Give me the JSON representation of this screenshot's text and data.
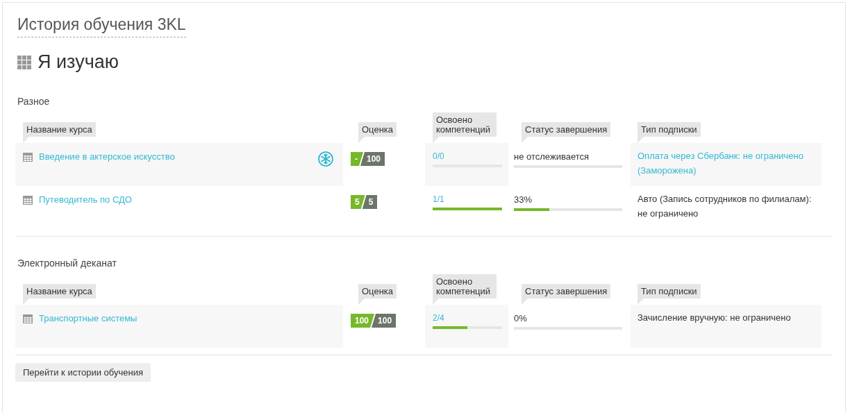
{
  "page_title": "История обучения 3KL",
  "heading": "Я изучаю",
  "sections": [
    {
      "title": "Разное",
      "columns": [
        "Название курса",
        "Оценка",
        "Освоено компетенций",
        "Статус завершения",
        "Тип подписки"
      ],
      "rows": [
        {
          "shaded": true,
          "name": "Введение в актерское искусство",
          "frozen": true,
          "grade": "-",
          "grade_max": "100",
          "competence": {
            "text": "0/0",
            "level": 0
          },
          "status": {
            "text": "не отслеживается",
            "level": 0
          },
          "subscription": "Оплата через Сбербанк: не ограничено (Заморожена)",
          "subscription_link": true
        },
        {
          "shaded": false,
          "name": "Путеводитель по СДО",
          "frozen": false,
          "grade": "5",
          "grade_max": "5",
          "competence": {
            "text": "1/1",
            "level": 1
          },
          "status": {
            "text": "33%",
            "level": 0.33
          },
          "subscription": "Авто (Запись сотрудников по филиалам): не ограничено",
          "subscription_link": false
        }
      ]
    },
    {
      "title": "Электронный деканат",
      "columns": [
        "Название курса",
        "Оценка",
        "Освоено компетенций",
        "Статус завершения",
        "Тип подписки"
      ],
      "rows": [
        {
          "shaded": true,
          "name": "Транспортные системы",
          "frozen": false,
          "grade": "100",
          "grade_max": "100",
          "competence": {
            "text": "2/4",
            "level": 0.5
          },
          "status": {
            "text": "0%",
            "level": 0
          },
          "subscription": "Зачисление вручную: не ограничено",
          "subscription_link": false
        }
      ]
    }
  ],
  "history_button": "Перейти к истории обучения"
}
